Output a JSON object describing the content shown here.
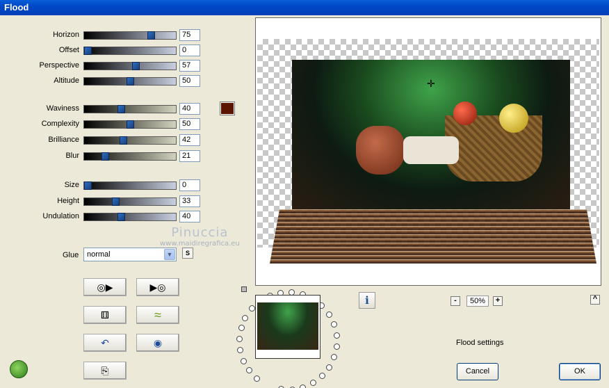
{
  "window": {
    "title": "Flood"
  },
  "sliders": [
    {
      "label": "Horizon",
      "value": "75",
      "level": 0.75
    },
    {
      "label": "Offset",
      "value": "0",
      "level": 0
    },
    {
      "label": "Perspective",
      "value": "57",
      "level": 0.57
    },
    {
      "label": "Altitude",
      "value": "50",
      "level": 0.5
    },
    {
      "label": "Waviness",
      "value": "40",
      "level": 0.4
    },
    {
      "label": "Complexity",
      "value": "50",
      "level": 0.5
    },
    {
      "label": "Brilliance",
      "value": "42",
      "level": 0.42
    },
    {
      "label": "Blur",
      "value": "21",
      "level": 0.21
    },
    {
      "label": "Size",
      "value": "0",
      "level": 0
    },
    {
      "label": "Height",
      "value": "33",
      "level": 0.33
    },
    {
      "label": "Undulation",
      "value": "40",
      "level": 0.4
    }
  ],
  "color_swatch": "#5b1400",
  "glue": {
    "label": "Glue",
    "value": "normal",
    "s_label": "S"
  },
  "watermark": {
    "name": "Pinuccia",
    "url": "www.maidiregrafica.eu"
  },
  "tools": [
    {
      "name": "previous-preset-icon"
    },
    {
      "name": "next-preset-icon"
    },
    {
      "name": "random-dice-icon"
    },
    {
      "name": "wave-icon"
    },
    {
      "name": "undo-icon"
    },
    {
      "name": "reset-icon"
    },
    {
      "name": "copy-icon"
    }
  ],
  "preview": {
    "zoom": "50%",
    "zoom_minus": "-",
    "zoom_plus": "+",
    "info": "i",
    "scroll": "^"
  },
  "status": {
    "settings_label": "Flood settings"
  },
  "buttons": {
    "cancel": "Cancel",
    "ok": "OK"
  }
}
